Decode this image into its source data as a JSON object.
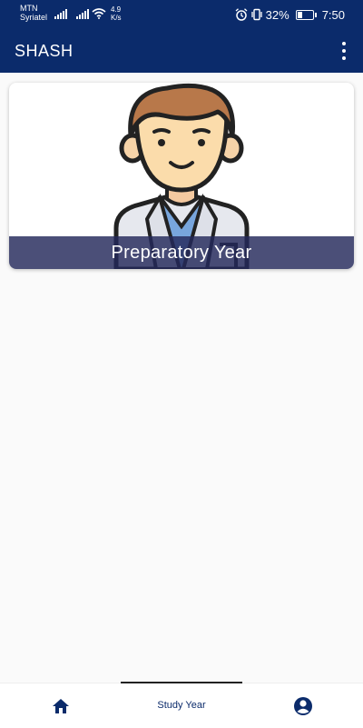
{
  "status_bar": {
    "carrier_1": "MTN",
    "carrier_2": "Syriatel",
    "speed_value": "4.9",
    "speed_unit": "K/s",
    "battery": "32%",
    "time": "7:50",
    "battery_level": 0.32
  },
  "app_bar": {
    "title": "SHASH",
    "menu_icon": "more-vert-icon"
  },
  "cards": [
    {
      "label": "Preparatory Year",
      "image": "doctor-avatar"
    }
  ],
  "bottom_nav": {
    "items": [
      {
        "icon": "home-icon"
      },
      {
        "label": "Study Year"
      },
      {
        "icon": "account-circle-icon"
      }
    ]
  },
  "colors": {
    "primary": "#0b2b6b",
    "card_overlay": "#23285a",
    "background": "#fafafa"
  }
}
